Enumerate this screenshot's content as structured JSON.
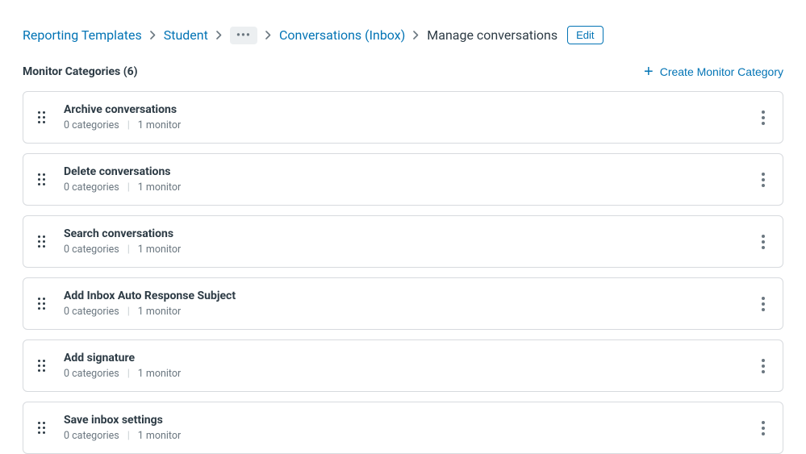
{
  "breadcrumb": {
    "items": [
      {
        "label": "Reporting Templates"
      },
      {
        "label": "Student"
      },
      {
        "label": "Conversations (Inbox)"
      }
    ],
    "current": "Manage conversations",
    "edit_label": "Edit"
  },
  "section": {
    "title": "Monitor Categories (6)",
    "create_label": "Create Monitor Category"
  },
  "cards": [
    {
      "title": "Archive conversations",
      "categories": "0 categories",
      "monitors": "1 monitor"
    },
    {
      "title": "Delete conversations",
      "categories": "0 categories",
      "monitors": "1 monitor"
    },
    {
      "title": "Search conversations",
      "categories": "0 categories",
      "monitors": "1 monitor"
    },
    {
      "title": "Add Inbox Auto Response Subject",
      "categories": "0 categories",
      "monitors": "1 monitor"
    },
    {
      "title": "Add signature",
      "categories": "0 categories",
      "monitors": "1 monitor"
    },
    {
      "title": "Save inbox settings",
      "categories": "0 categories",
      "monitors": "1 monitor"
    }
  ]
}
